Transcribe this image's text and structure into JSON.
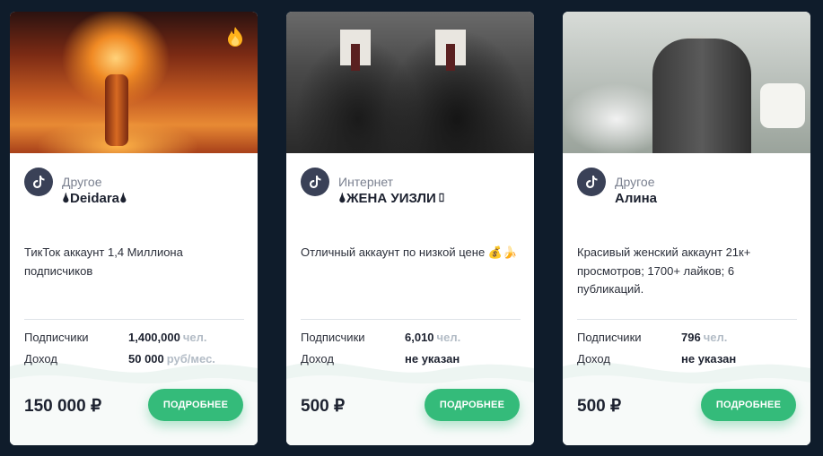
{
  "colors": {
    "page_background": "#0f1c2b",
    "card_background": "#ffffff",
    "avatar": "#3a4157",
    "button": "#34bb7a",
    "unit_text": "#b3bcc6"
  },
  "cards": [
    {
      "image": "nuclear-explosion-photo",
      "badge_icon": "fire-icon",
      "platform_icon": "tiktok-icon",
      "category": "Другое",
      "name": "🌢Deidara🌢",
      "description": "ТикТок аккаунт 1,4 Миллиона подписчиков",
      "stats": [
        {
          "label": "Подписчики",
          "value": "1,400,000",
          "unit": "чел."
        },
        {
          "label": "Доход",
          "value": "50 000",
          "unit": "руб/мес."
        }
      ],
      "price": "150 000 ₽",
      "button_label": "ПОДРОБНЕЕ"
    },
    {
      "image": "two-students-photo",
      "platform_icon": "tiktok-icon",
      "category": "Интернет",
      "name": "🌢ЖЕНА УИЗЛИ▯",
      "description": "Отличный аккаунт по низкой цене 💰🍌",
      "stats": [
        {
          "label": "Подписчики",
          "value": "6,010",
          "unit": "чел."
        },
        {
          "label": "Доход",
          "value": "не указан",
          "unit": ""
        }
      ],
      "price": "500 ₽",
      "button_label": "ПОДРОБНЕЕ"
    },
    {
      "image": "woman-in-bedroom-photo",
      "platform_icon": "tiktok-icon",
      "category": "Другое",
      "name": "Алина",
      "description": "Красивый женский аккаунт 21к+ просмотров; 1700+ лайков; 6 публикаций.",
      "stats": [
        {
          "label": "Подписчики",
          "value": "796",
          "unit": "чел."
        },
        {
          "label": "Доход",
          "value": "не указан",
          "unit": ""
        }
      ],
      "price": "500 ₽",
      "button_label": "ПОДРОБНЕЕ"
    }
  ]
}
